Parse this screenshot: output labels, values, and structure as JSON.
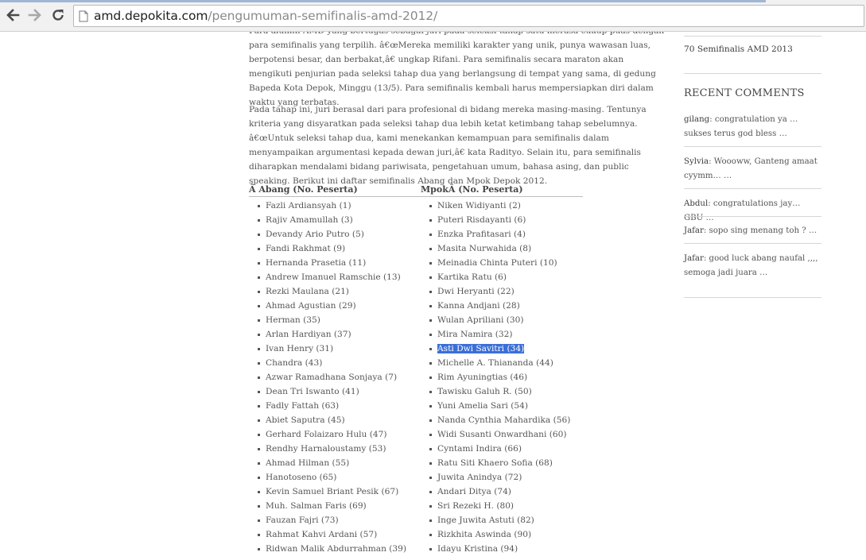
{
  "browser": {
    "url_host": "amd.depokita.com",
    "url_path": "/pengumuman-semifinalis-amd-2012/"
  },
  "post": {
    "para1": "Para alumni AMD yang bertugas sebagai juri pada seleksi tahap satu merasa cukup puas dengan para semifinalis yang terpilih. â€œMereka memiliki karakter yang unik, punya wawasan luas, berpotensi besar, dan berbakat,â€ ungkap Rifani. Para semifinalis secara maraton akan mengikuti penjurian pada seleksi tahap dua yang berlangsung di tempat yang sama, di gedung Bapeda Kota Depok, Minggu (13/5). Para semifinalis kembali harus mempersiapkan diri dalam waktu yang terbatas.",
    "para2": "Pada tahap ini, juri berasal dari para profesional di bidang mereka masing-masing. Tentunya kriteria yang disyaratkan pada seleksi tahap dua lebih ketat ketimbang tahap sebelumnya. â€œUntuk seleksi tahap dua, kami menekankan kemampuan para semifinalis dalam menyampaikan argumentasi kepada dewan juri,â€ kata Radityo. Selain itu, para semifinalis diharapkan mendalami bidang pariwisata, pengetahuan umum, bahasa asing, dan public speaking. Berikut ini daftar semifinalis Abang dan Mpok Depok 2012."
  },
  "table": {
    "abang_header": "Â Abang (No. Peserta)",
    "mpok_header": "MpokÂ (No. Peserta)",
    "abang": [
      "Fazli Ardiansyah (1)",
      "Rajiv Amamullah (3)",
      "Devandy Ario Putro (5)",
      "Fandi Rakhmat (9)",
      "Hernanda Prasetia (11)",
      "Andrew Imanuel Ramschie (13)",
      "Rezki Maulana (21)",
      "Ahmad Agustian (29)",
      "Herman (35)",
      "Arlan Hardiyan (37)",
      "Ivan Henry (31)",
      "Chandra (43)",
      "Azwar Ramadhana Sonjaya (7)",
      "Dean Tri Iswanto (41)",
      "Fadly Fattah (63)",
      "Abiet Saputra (45)",
      "Gerhard Folaizaro Hulu (47)",
      "Rendhy Harnaloustamy (53)",
      "Ahmad Hilman (55)",
      "Hanotoseno (65)",
      "Kevin Samuel Briant Pesik (67)",
      "Muh. Salman Faris (69)",
      "Fauzan Fajri (73)",
      "Rahmat Kahvi Ardani (57)",
      "Ridwan Malik Abdurrahman (39)"
    ],
    "mpok": [
      "Niken Widiyanti (2)",
      "Puteri Risdayanti (6)",
      "Enzka Prafitasari (4)",
      "Masita Nurwahida (8)",
      "Meinadia Chinta Puteri (10)",
      "Kartika Ratu (6)",
      "Dwi Heryanti (22)",
      "Kanna Andjani (28)",
      "Wulan Apriliani (30)",
      "Mira Namira (32)",
      "Asti Dwi Savitri (34)",
      "Michelle A. Thiananda (44)",
      "Rim Ayuningtias (46)",
      "Tawisku Galuh R. (50)",
      "Yuni Amelia Sari (54)",
      "Nanda Cynthia Mahardika (56)",
      "Widi Susanti Onwardhani (60)",
      "Cyntami Indira (66)",
      "Ratu Siti Khaero Sofia (68)",
      "Juwita Anindya (72)",
      "Andari Ditya (74)",
      "Sri Rezeki H. (80)",
      "Inge Juwita Astuti (82)",
      "Rizkhita Aswinda (90)",
      "Idayu Kristina (94)"
    ],
    "selected_mpok_index": 10
  },
  "sidebar": {
    "top_link": "70 Semifinalis AMD 2013",
    "recent_title": "RECENT COMMENTS",
    "comments": [
      {
        "author": "gilang",
        "text": ": congratulation ya … sukses terus god bless …"
      },
      {
        "author": "Sylvia",
        "text": ": Woooww, Ganteng amaat cyymm… …"
      },
      {
        "author": "Abdul",
        "text": ": congratulations jay… GBU …"
      },
      {
        "author": "Jafar",
        "text": ": sopo sing menang toh ? …"
      },
      {
        "author": "Jafar",
        "text": ": good luck abang naufal ,,,, semoga jadi juara …"
      }
    ]
  },
  "colors": {
    "selection": "#3a6fd8",
    "text": "#555555"
  },
  "icons": [
    "back-arrow-icon",
    "forward-arrow-icon",
    "reload-icon",
    "page-icon"
  ]
}
